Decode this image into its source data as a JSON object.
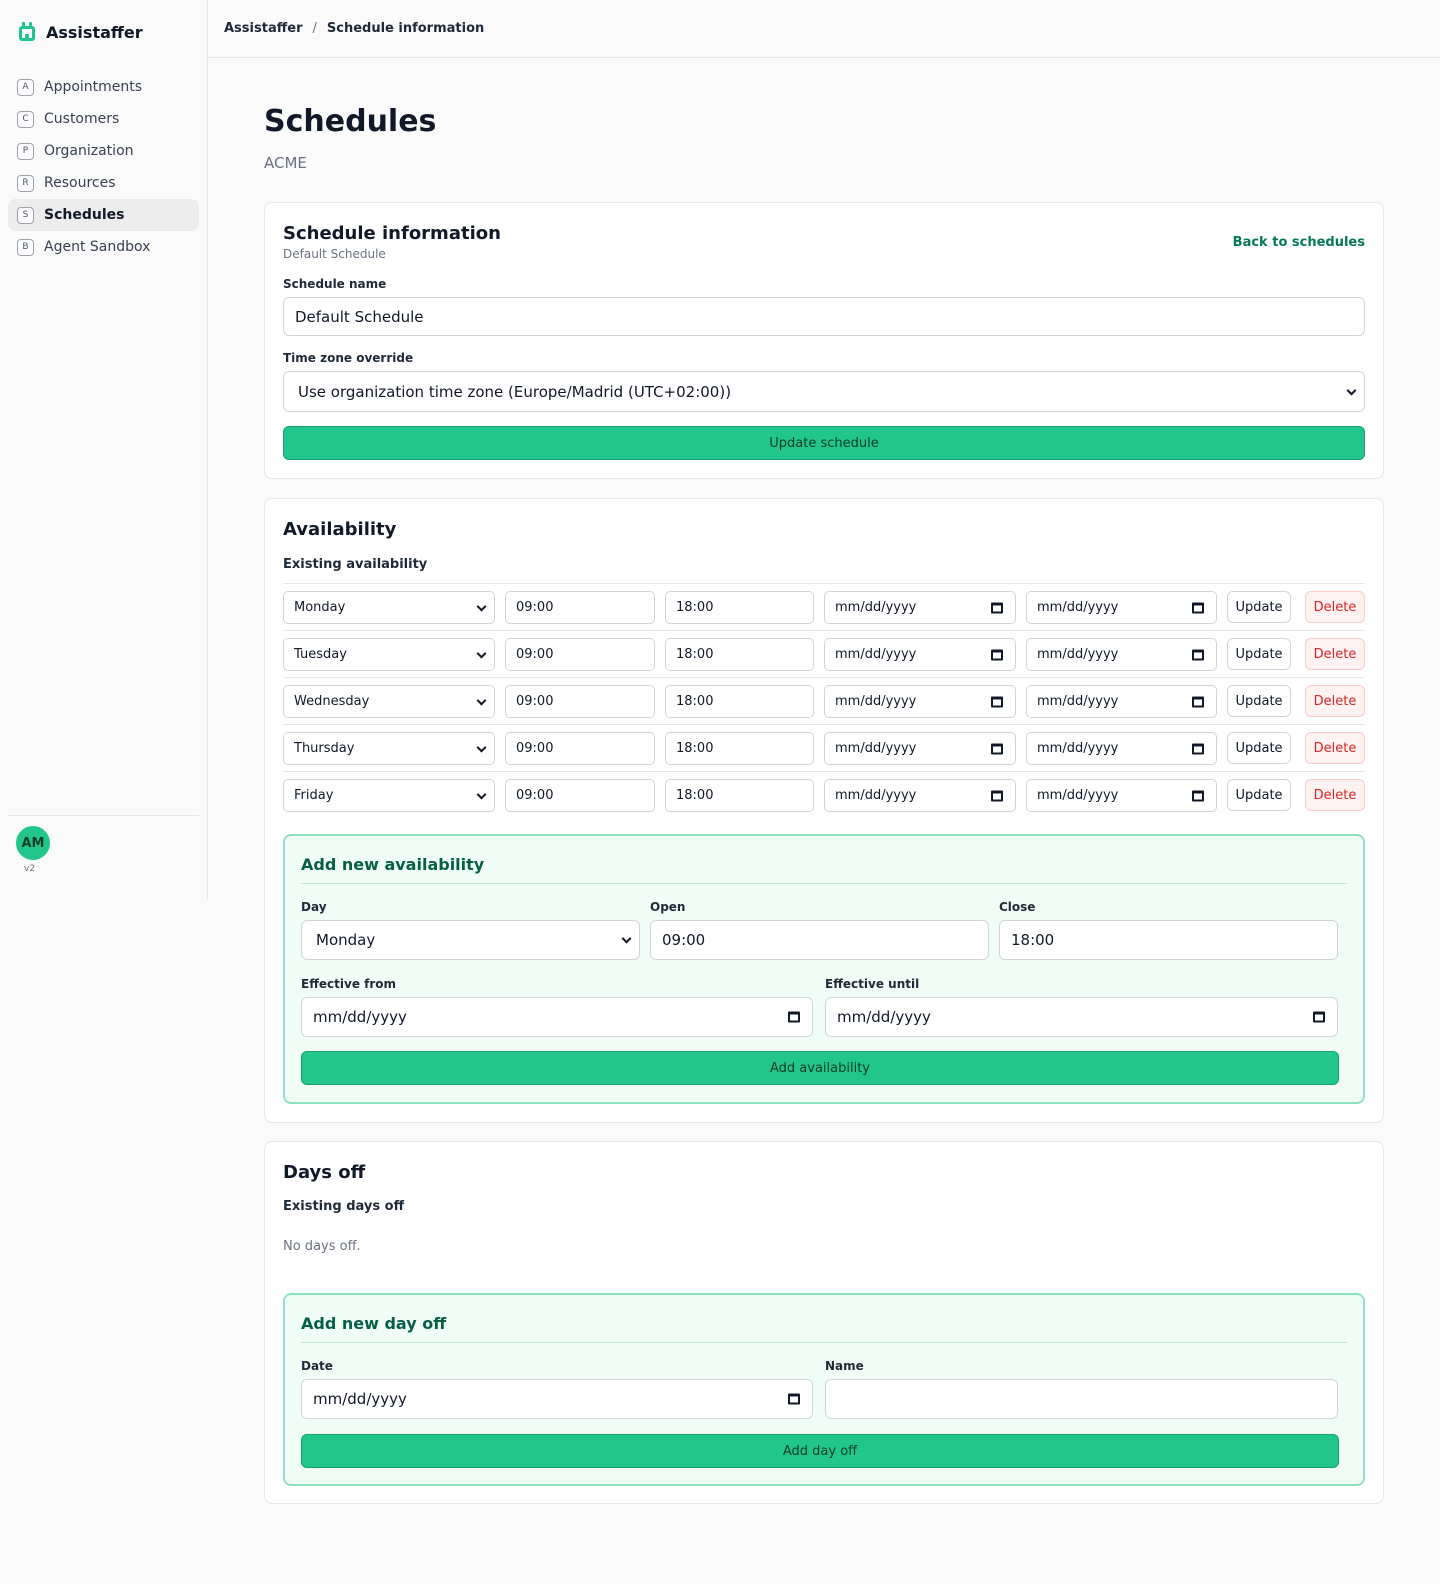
{
  "app": {
    "name": "Assistaffer",
    "version": "v2",
    "avatar_initials": "AM"
  },
  "sidebar": {
    "items": [
      {
        "key": "A",
        "label": "Appointments",
        "active": false
      },
      {
        "key": "C",
        "label": "Customers",
        "active": false
      },
      {
        "key": "P",
        "label": "Organization",
        "active": false
      },
      {
        "key": "R",
        "label": "Resources",
        "active": false
      },
      {
        "key": "S",
        "label": "Schedules",
        "active": true
      },
      {
        "key": "B",
        "label": "Agent Sandbox",
        "active": false
      }
    ]
  },
  "breadcrumb": {
    "root": "Assistaffer",
    "separator": "/",
    "current": "Schedule information"
  },
  "page": {
    "title": "Schedules",
    "subtitle": "ACME"
  },
  "schedule_info": {
    "title": "Schedule information",
    "subtitle": "Default Schedule",
    "back_link": "Back to schedules",
    "name_label": "Schedule name",
    "name_value": "Default Schedule",
    "timezone_label": "Time zone override",
    "timezone_value": "Use organization time zone (Europe/Madrid (UTC+02:00))",
    "submit_label": "Update schedule"
  },
  "availability": {
    "title": "Availability",
    "existing_label": "Existing availability",
    "update_label": "Update",
    "delete_label": "Delete",
    "date_placeholder": "mm/dd/yyyy",
    "rows": [
      {
        "day": "Monday",
        "open": "09:00",
        "close": "18:00",
        "from": "mm/dd/yyyy",
        "until": "mm/dd/yyyy"
      },
      {
        "day": "Tuesday",
        "open": "09:00",
        "close": "18:00",
        "from": "mm/dd/yyyy",
        "until": "mm/dd/yyyy"
      },
      {
        "day": "Wednesday",
        "open": "09:00",
        "close": "18:00",
        "from": "mm/dd/yyyy",
        "until": "mm/dd/yyyy"
      },
      {
        "day": "Thursday",
        "open": "09:00",
        "close": "18:00",
        "from": "mm/dd/yyyy",
        "until": "mm/dd/yyyy"
      },
      {
        "day": "Friday",
        "open": "09:00",
        "close": "18:00",
        "from": "mm/dd/yyyy",
        "until": "mm/dd/yyyy"
      }
    ],
    "add": {
      "title": "Add new availability",
      "day_label": "Day",
      "day_value": "Monday",
      "open_label": "Open",
      "open_value": "09:00",
      "close_label": "Close",
      "close_value": "18:00",
      "from_label": "Effective from",
      "from_value": "mm/dd/yyyy",
      "until_label": "Effective until",
      "until_value": "mm/dd/yyyy",
      "submit_label": "Add availability"
    }
  },
  "days_off": {
    "title": "Days off",
    "existing_label": "Existing days off",
    "empty_text": "No days off.",
    "add": {
      "title": "Add new day off",
      "date_label": "Date",
      "date_value": "mm/dd/yyyy",
      "name_label": "Name",
      "name_value": "",
      "submit_label": "Add day off"
    }
  },
  "colors": {
    "accent": "#22c58b",
    "accent_dark": "#065f46",
    "danger": "#dc2626"
  },
  "icons": {
    "brand": "calendar-icon",
    "select": "chevron-down-icon",
    "date": "calendar-icon"
  }
}
